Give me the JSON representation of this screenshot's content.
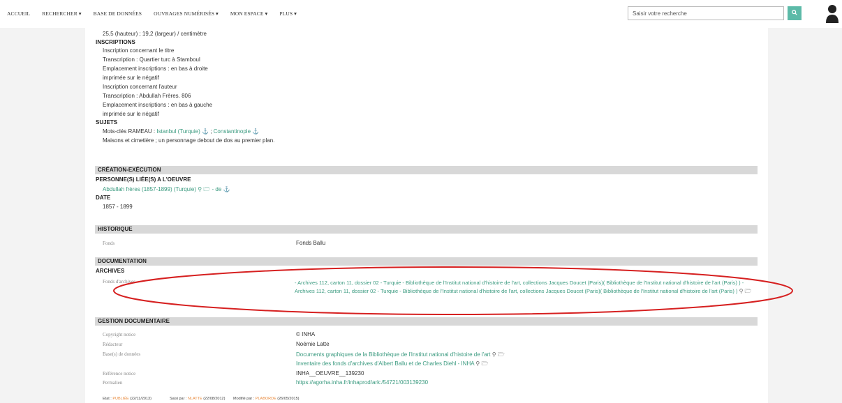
{
  "nav": [
    "ACCUEIL",
    "RECHERCHER ▾",
    "BASE DE DONNÉES",
    "OUVRAGES NUMÉRISÉS ▾",
    "MON ESPACE ▾",
    "PLUS ▾"
  ],
  "search": {
    "placeholder": "Saisir votre recherche"
  },
  "top": {
    "dimensions": "25,5 (hauteur) ; 19,2 (largeur) / centimètre",
    "inscriptions_title": "INSCRIPTIONS",
    "inscriptions": [
      "Inscription concernant le titre",
      "Transcription : Quartier turc à Stamboul",
      "Emplacement inscriptions : en bas à droite",
      "imprimée sur le négatif",
      "Inscription concernant l'auteur",
      "Transcription : Abdullah Frères. 806",
      "Emplacement inscriptions : en bas à gauche",
      "imprimée sur le négatif"
    ],
    "sujets_title": "SUJETS",
    "rameau_label": "Mots-clés RAMEAU :",
    "rameau_link1": "Istanbul (Turquie)",
    "rameau_link2": "Constantinople",
    "sujet_desc": "Maisons et cimetière ; un personnage debout de dos au premier plan."
  },
  "creation": {
    "title": "CRÉATION-EXÉCUTION",
    "person_title": "PERSONNE(S) LIÉE(S) A L'OEUVRE",
    "person_link": "Abdullah frères (1857-1899) (Turquie)",
    "person_suffix": "- de",
    "date_title": "DATE",
    "date_value": "1857 - 1899"
  },
  "historique": {
    "title": "HISTORIQUE",
    "fonds_label": "Fonds",
    "fonds_value": "Fonds Ballu"
  },
  "documentation": {
    "title": "DOCUMENTATION",
    "archives_title": "ARCHIVES",
    "fonds_label": "Fonds d'archives",
    "archives_text": "- Archives 112, carton 11, dossier 02 - Turquie - Bibliothèque de l'Institut national d'histoire de l'art, collections Jacques Doucet (Paris)( Bibliothèque de l'Institut national d'histoire de l'art (Paris) )  - Archives 112, carton 11, dossier 02 - Turquie - Bibliothèque de l'Institut national d'histoire de l'art, collections Jacques Doucet (Paris)( Bibliothèque de l'Institut national d'histoire de l'art (Paris) )"
  },
  "gestion": {
    "title": "GESTION DOCUMENTAIRE",
    "copyright_label": "Copyright notice",
    "copyright_value": "© INHA",
    "redacteur_label": "Rédacteur",
    "redacteur_value": "Noémie Latte",
    "bases_label": "Base(s) de données",
    "base1": "Documents graphiques de la Bibliothèque de l'Institut national d'histoire de l'art",
    "base2": "Inventaire des fonds d'archives d'Albert Ballu et de Charles Diehl - INHA",
    "ref_label": "Référence notice",
    "ref_value": "INHA__OEUVRE__139230",
    "permalien_label": "Permalien",
    "permalien_value": "https://agorha.inha.fr/inhaprod/ark:/54721/003139230"
  },
  "footer": {
    "etat_label": "Etat :",
    "etat_value": "PUBLIÉE",
    "etat_date": "(22/11/2013)",
    "saisi_label": "Saisi par :",
    "saisi_value": "NLATTE",
    "saisi_date": "(22/08/2012)",
    "modifie_label": "Modifié par :",
    "modifie_value": "PLABORDE",
    "modifie_date": "(26/05/2015)"
  },
  "colors": {
    "accent": "#3a9a7f",
    "search_button": "#5cbaa8",
    "section_bg": "#d8d8d8",
    "annotation": "#d62020"
  }
}
